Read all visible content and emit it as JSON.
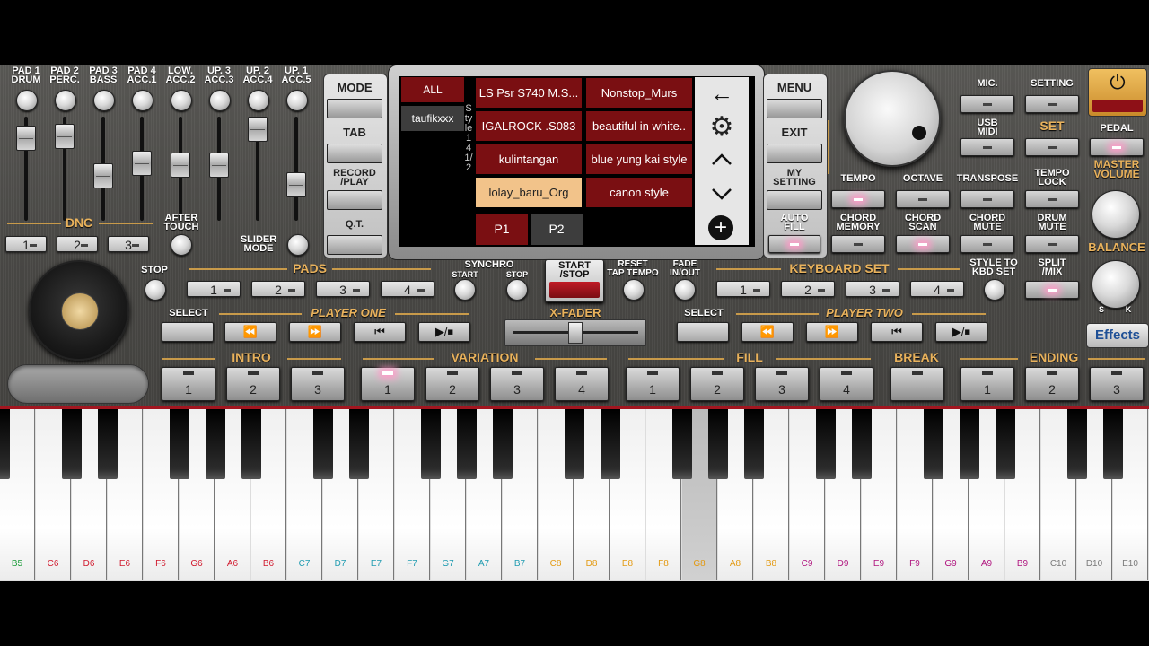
{
  "pads_sliders": {
    "labels": [
      "PAD 1\nDRUM",
      "PAD 2\nPERC.",
      "PAD 3\nBASS",
      "PAD 4\nACC.1",
      "LOW.\nACC.2",
      "UP. 3\nACC.3",
      "UP. 2\nACC.4",
      "UP. 1\nACC.5"
    ]
  },
  "dnc": {
    "title": "DNC",
    "buttons": [
      "1",
      "2",
      "3"
    ],
    "after_touch": "AFTER\nTOUCH",
    "slider_mode": "SLIDER\nMODE"
  },
  "left_buttons": {
    "mode": "MODE",
    "tab": "TAB",
    "record_play": "RECORD\n/PLAY",
    "qt": "Q.T."
  },
  "style_browser": {
    "categories": [
      "ALL",
      "taufikxxx"
    ],
    "vertical_label": "Style 14 1/2",
    "items": [
      "LS Psr S740 M.S...",
      "Nonstop_Murs",
      "IGALROCK .S083",
      "beautiful in white..",
      "kulintangan",
      "blue yung kai style",
      "lolay_baru_Org",
      "canon style"
    ],
    "pages": [
      "P1",
      "P2"
    ]
  },
  "right_menu": {
    "menu": "MENU",
    "exit": "EXIT",
    "my_setting": "MY\nSETTING",
    "auto_fill": "AUTO\nFILL"
  },
  "top_right": {
    "mic": "MIC.",
    "setting": "SETTING",
    "usb_midi": "USB\nMIDI",
    "set": "SET",
    "pedal": "PEDAL"
  },
  "controls_row": {
    "tempo": "TEMPO",
    "octave": "OCTAVE",
    "transpose": "TRANSPOSE",
    "tempo_lock": "TEMPO\nLOCK",
    "chord_memory": "CHORD\nMEMORY",
    "chord_scan": "CHORD\nSCAN",
    "chord_mute": "CHORD\nMUTE",
    "drum_mute": "DRUM\nMUTE"
  },
  "master": {
    "volume": "MASTER\nVOLUME",
    "balance": "BALANCE",
    "s": "S",
    "k": "K"
  },
  "pads_row": {
    "stop": "STOP",
    "title": "PADS",
    "buttons": [
      "1",
      "2",
      "3",
      "4"
    ]
  },
  "synchro": {
    "title": "SYNCHRO",
    "start": "START",
    "stop": "STOP"
  },
  "start_stop": "START\n/STOP",
  "reset": "RESET\nTAP TEMPO",
  "fade": "FADE\nIN/OUT",
  "keyboard_set": {
    "title": "KEYBOARD SET",
    "buttons": [
      "1",
      "2",
      "3",
      "4"
    ],
    "style_to_kbd": "STYLE TO\nKBD SET",
    "split_mix": "SPLIT\n/MIX"
  },
  "player_one": {
    "select": "SELECT",
    "title": "PLAYER ONE",
    "controls": [
      "⏪",
      "⏩",
      "⏮",
      "▶/⏹"
    ]
  },
  "x_fader": "X-FADER",
  "player_two": {
    "select": "SELECT",
    "title": "PLAYER TWO",
    "controls": [
      "⏪",
      "⏩",
      "⏮",
      "▶/⏹"
    ]
  },
  "effects": "Effects",
  "sections": {
    "intro": "INTRO",
    "variation": "VARIATION",
    "fill": "FILL",
    "break": "BREAK",
    "ending": "ENDING",
    "intro_buttons": [
      "1",
      "2",
      "3"
    ],
    "variation_buttons": [
      "1",
      "2",
      "3",
      "4"
    ],
    "fill_buttons": [
      "1",
      "2",
      "3",
      "4"
    ],
    "ending_buttons": [
      "1",
      "2",
      "3"
    ]
  },
  "keyboard": {
    "white_keys": [
      "B5",
      "C6",
      "D6",
      "E6",
      "F6",
      "G6",
      "A6",
      "B6",
      "C7",
      "D7",
      "E7",
      "F7",
      "G7",
      "A7",
      "B7",
      "C8",
      "D8",
      "E8",
      "F8",
      "G8",
      "A8",
      "B8",
      "C9",
      "D9",
      "E9",
      "F9",
      "G9",
      "A9",
      "B9",
      "C10",
      "D10",
      "E10"
    ],
    "pressed_key": "G8",
    "colors": {
      "6": "#d0182c",
      "7": "#1f9bb0",
      "8": "#e39a12",
      "9": "#b0157f",
      "10": "#7a7a7a",
      "5": "#1c9c3a"
    }
  },
  "colors": {
    "accent_gold": "#e9b25c",
    "style_red": "#7a0f12",
    "selected_style": "#f2c38a",
    "power": "#e0a84a"
  }
}
